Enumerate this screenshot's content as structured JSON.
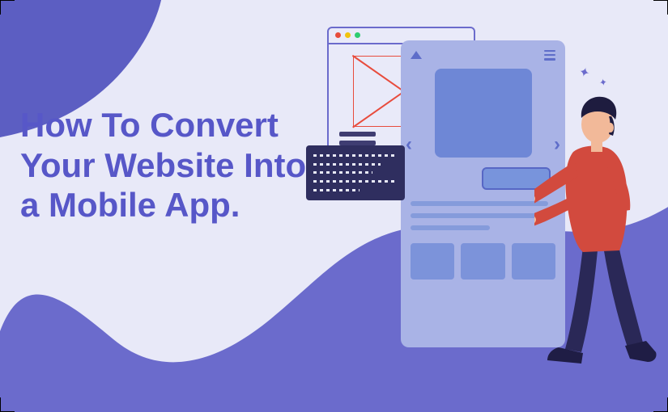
{
  "headline": "How To Convert Your Website Into a Mobile App.",
  "colors": {
    "background": "#E8E9F8",
    "primary": "#5C5EC2",
    "blob": "#6B6BCC",
    "phone_body": "#A9B3E6",
    "phone_accent": "#6E87D6",
    "code_box": "#2F2E5F",
    "wire_red": "#E84C3D",
    "person_shirt": "#D24A3E",
    "person_pants": "#2A2857"
  },
  "illustration": {
    "browser_dots": [
      "red",
      "yellow",
      "green"
    ],
    "phone_nav_left": "‹",
    "phone_nav_right": "›",
    "sparkle": "✦"
  }
}
